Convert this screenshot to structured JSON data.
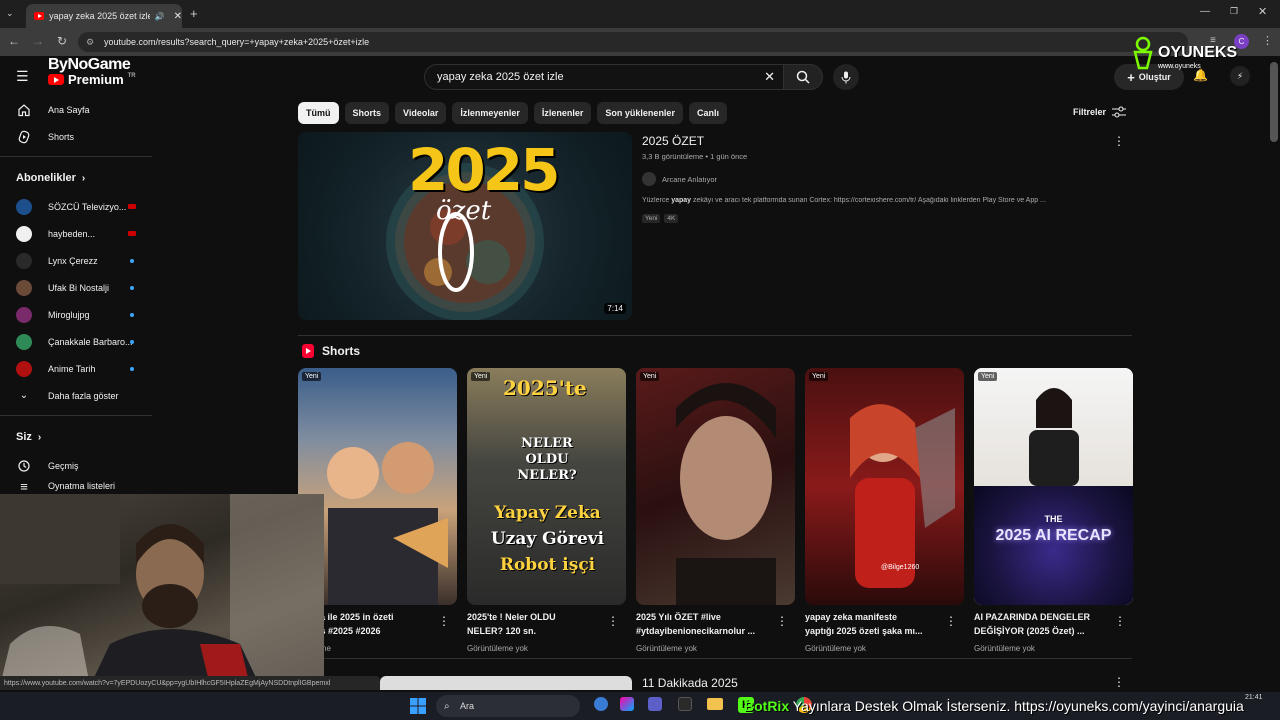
{
  "browser": {
    "tab_title": "yapay zeka 2025 özet izle -",
    "url": "youtube.com/results?search_query=+yapay+zeka+2025+özet+izle",
    "profile_initial": "C"
  },
  "overlay": {
    "logo_line1": "ByNoGame",
    "logo_line2": "Premium",
    "logo_tr": "TR",
    "watermark": "OYUNEKS",
    "watermark_sub": "www.oyuneks",
    "ticker": "Yayınlara Destek Olmak İsterseniz. https://oyuneks.com/yayinci/anarguia",
    "ticker_brand": "BotRix",
    "status_url": "https://www.youtube.com/watch?v=7yEPDUozyCU&pp=ygUbIHlhcGF5IHplaZEgMjAyNSDDtnplIGBpemxl"
  },
  "header": {
    "search_value": "yapay zeka 2025 özet izle",
    "create_label": "Oluştur"
  },
  "sidebar": {
    "home": "Ana Sayfa",
    "shorts": "Shorts",
    "subs_header": "Abonelikler",
    "subs": [
      {
        "name": "SÖZCÜ Televizyo...",
        "status": "live",
        "color": "#1d4f8c"
      },
      {
        "name": "haybeden...",
        "status": "live",
        "color": "#f0f0f0"
      },
      {
        "name": "Lynx Çerezz",
        "status": "new",
        "color": "#2a2a2a"
      },
      {
        "name": "Ufak Bi Nostalji",
        "status": "new",
        "color": "#6b4a3a"
      },
      {
        "name": "Miroglujpg",
        "status": "new",
        "color": "#7a2a6b"
      },
      {
        "name": "Çanakkale Barbaro...",
        "status": "new",
        "color": "#2e8b57"
      },
      {
        "name": "Anime Tarih",
        "status": "new",
        "color": "#b01010"
      }
    ],
    "more": "Daha fazla göster",
    "you_header": "Siz",
    "history": "Geçmiş",
    "playlists": "Oynatma listeleri"
  },
  "chips": [
    "Tümü",
    "Shorts",
    "Videolar",
    "İzlenmeyenler",
    "İzlenenler",
    "Son yüklenenler",
    "Canlı"
  ],
  "filters_label": "Filtreler",
  "video": {
    "title": "2025 ÖZET",
    "meta": "3,3 B görüntüleme • 1 gün önce",
    "channel": "Arcane Anlatıyor",
    "desc_pre": "Yüzlerce ",
    "desc_bold": "yapay",
    "desc_post": " zekâyı ve aracı tek platformda sunan Cortex: https://cortexishere.com/tr/ Aşağıdaki linklerden Play Store ve App ...",
    "badges": [
      "Yeni",
      "4K"
    ],
    "duration": "7:14",
    "thumb_big": "2025",
    "thumb_word": "özet"
  },
  "shorts_header": "Shorts",
  "shorts": [
    {
      "new": "Yeni",
      "title1": "y zeka ile 2025 in özeti",
      "title2": "shorts #2025  #2026",
      "views": "üntüleme",
      "caption": ""
    },
    {
      "new": "Yeni",
      "title1": "2025'te ! Neler OLDU",
      "title2": "NELER? 120 sn.",
      "views": "Görüntüleme yok",
      "caption": "2025'te"
    },
    {
      "new": "Yeni",
      "title1": "2025 Yılı ÖZET #live",
      "title2": "#ytdayibenionecikarnolur ...",
      "views": "Görüntüleme yok",
      "caption": ""
    },
    {
      "new": "Yeni",
      "title1": "yapay zeka manifeste",
      "title2": "yaptığı 2025 özeti şaka mı...",
      "views": "Görüntüleme yok",
      "caption": "@Bilge1260"
    },
    {
      "new": "Yeni",
      "title1": "AI PAZARINDA DENGELER",
      "title2": "DEĞİŞİYOR (2025 Özet) ...",
      "views": "Görüntüleme yok",
      "caption": "2025 AI RECAP"
    }
  ],
  "short2_lines": [
    "NELER",
    "OLDU",
    "NELER?",
    "Yapay Zeka",
    "Uzay Görevi",
    "Robot işçi"
  ],
  "short5_the": "THE",
  "next_video_title": "11 Dakikada 2025",
  "taskbar": {
    "search": "Ara",
    "time": "21:41"
  }
}
